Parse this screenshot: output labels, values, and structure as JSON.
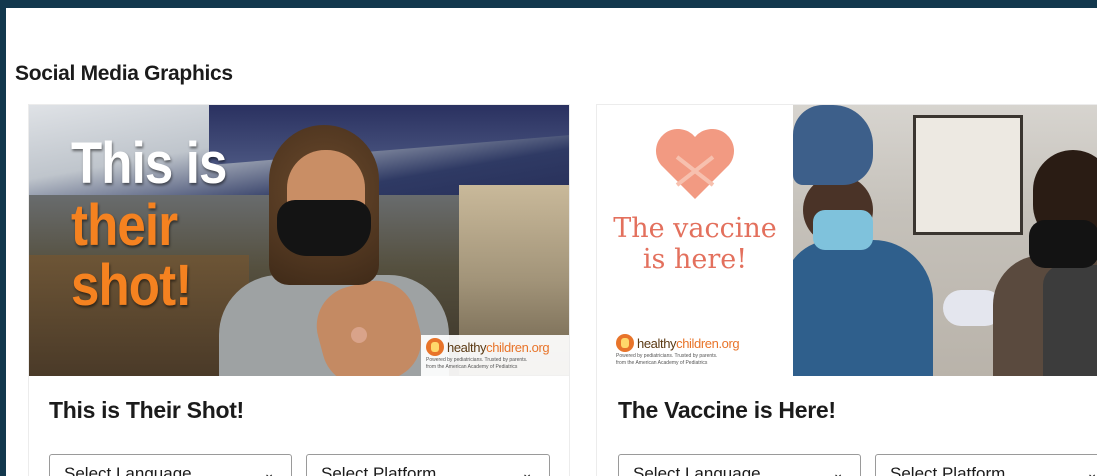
{
  "section": {
    "title": "Social Media Graphics"
  },
  "cards": [
    {
      "image_text": {
        "line1": "This is",
        "line2": "their",
        "line3": "shot!"
      },
      "logo": {
        "word1": "healthy",
        "word2": "children.org",
        "tagline": "Powered by pediatricians. Trusted by parents.",
        "tagline2": "from the American Academy of Pediatrics"
      },
      "title": "This is Their Shot!",
      "language_select": "Select Language",
      "platform_select": "Select Platform"
    },
    {
      "image_text": {
        "line1": "The vaccine",
        "line2": "is here!"
      },
      "logo": {
        "word1": "healthy",
        "word2": "children.org",
        "tagline": "Powered by pediatricians. Trusted by parents.",
        "tagline2": "from the American Academy of Pediatrics"
      },
      "title": "The Vaccine is Here!",
      "language_select": "Select Language",
      "platform_select": "Select Platform"
    }
  ],
  "colors": {
    "header_band": "#12384d",
    "accent_orange": "#f58220",
    "coral": "#e3705d"
  },
  "icons": {
    "dropdown": "chevron-down-icon"
  }
}
